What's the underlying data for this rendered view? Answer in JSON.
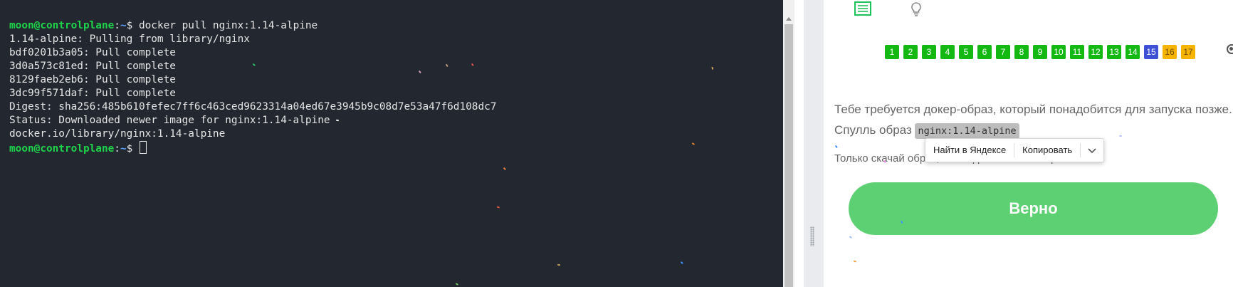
{
  "terminal": {
    "prompt_user": "moon@controlplane",
    "prompt_sep": ":",
    "prompt_path": "~",
    "prompt_symbol": "$ ",
    "command": "docker pull nginx:1.14-alpine",
    "output": [
      "1.14-alpine: Pulling from library/nginx",
      "bdf0201b3a05: Pull complete",
      "3d0a573c81ed: Pull complete",
      "8129faeb2eb6: Pull complete",
      "3dc99f571daf: Pull complete",
      "Digest: sha256:485b610fefec7ff6c463ced9623314a04ed67e3945b9c08d7e53a47f6d108dc7",
      "Status: Downloaded newer image for nginx:1.14-alpine",
      "docker.io/library/nginx:1.14-alpine"
    ]
  },
  "panel": {
    "top_icons": [
      "list-icon",
      "lightbulb-icon"
    ],
    "steps": [
      {
        "label": "1",
        "state": "done"
      },
      {
        "label": "2",
        "state": "done"
      },
      {
        "label": "3",
        "state": "done"
      },
      {
        "label": "4",
        "state": "done"
      },
      {
        "label": "5",
        "state": "done"
      },
      {
        "label": "6",
        "state": "done"
      },
      {
        "label": "7",
        "state": "done"
      },
      {
        "label": "8",
        "state": "done"
      },
      {
        "label": "9",
        "state": "done"
      },
      {
        "label": "10",
        "state": "done"
      },
      {
        "label": "11",
        "state": "done"
      },
      {
        "label": "12",
        "state": "done"
      },
      {
        "label": "13",
        "state": "done"
      },
      {
        "label": "14",
        "state": "done"
      },
      {
        "label": "15",
        "state": "active"
      },
      {
        "label": "16",
        "state": "pending"
      },
      {
        "label": "17",
        "state": "pending"
      }
    ],
    "task": {
      "line1": "Тебе требуется докер-образ, который понадобится для запуска позже.",
      "line2_prefix": "Спулль образ ",
      "image_name": "nginx:1.14-alpine",
      "note": "Только скачай образ, не создавай контейнер."
    },
    "context_menu": {
      "search_label": "Найти в Яндексе",
      "copy_label": "Копировать"
    },
    "submit_label": "Верно"
  },
  "colors": {
    "terminal_bg": "#222730",
    "prompt_user": "#1fd34a",
    "prompt_path": "#5aa4ff",
    "step_done": "#13b813",
    "step_active": "#3d50d6",
    "step_pending": "#f5b400",
    "submit_button": "#5ed074"
  }
}
